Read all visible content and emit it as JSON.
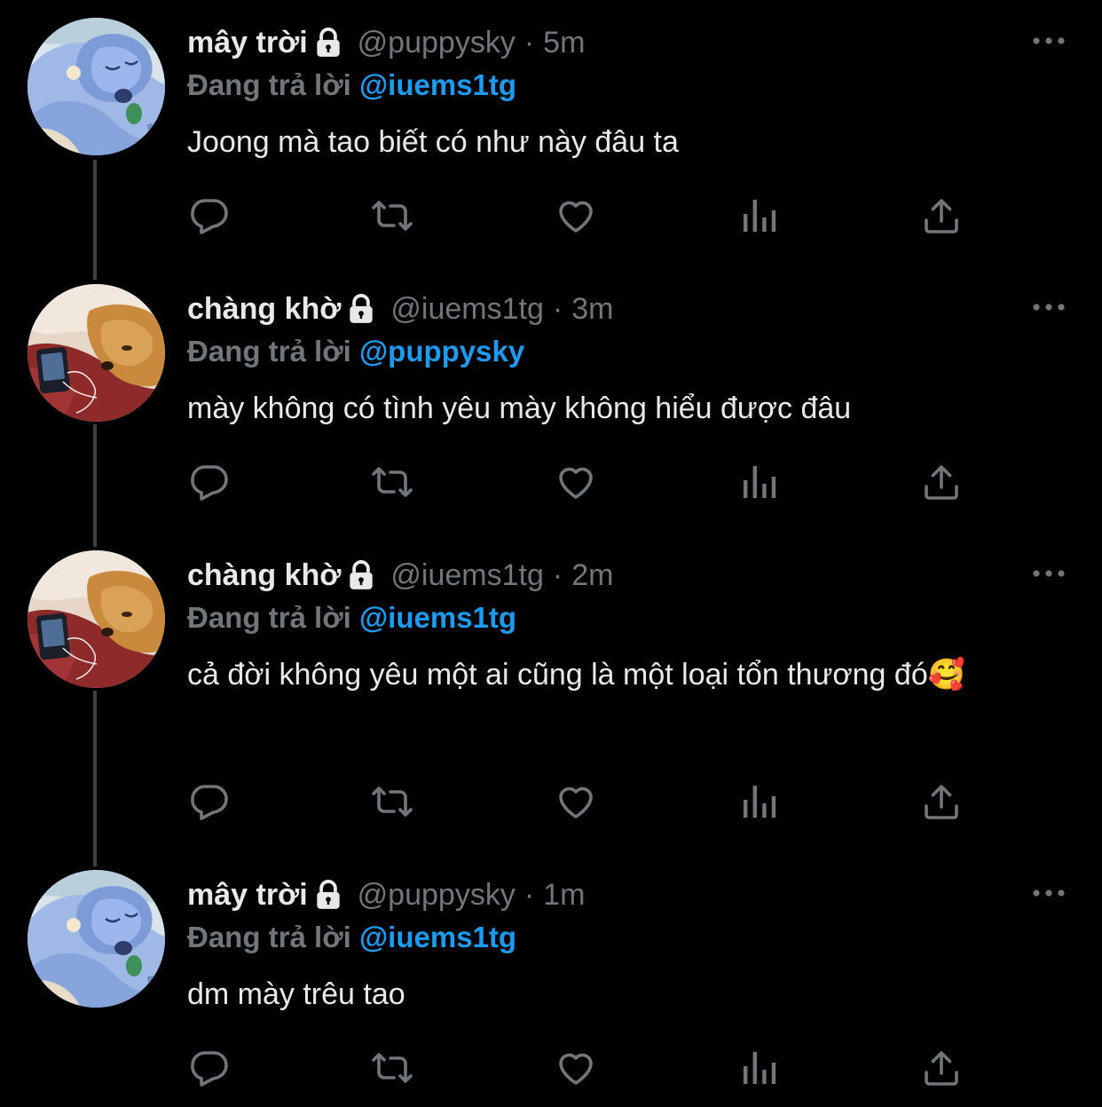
{
  "colors": {
    "background": "#000000",
    "text_primary": "#e7e9ea",
    "text_secondary": "#71767b",
    "accent": "#1d9bf0",
    "thread_line": "#3e4144"
  },
  "tweets": [
    {
      "display_name": "mây trời",
      "protected_icon": "lock-icon",
      "handle": "@puppysky",
      "separator": "·",
      "time": "5m",
      "reply_prefix": "Đang trả lời",
      "reply_to": "@iuems1tg",
      "text": "Joong mà tao biết có như này đâu ta",
      "avatar": "stitch-avatar"
    },
    {
      "display_name": "chàng khờ",
      "protected_icon": "lock-icon",
      "handle": "@iuems1tg",
      "separator": "·",
      "time": "3m",
      "reply_prefix": "Đang trả lời",
      "reply_to": "@puppysky",
      "text": "mày không có tình yêu mày không hiểu được đâu",
      "avatar": "dog-avatar"
    },
    {
      "display_name": "chàng khờ",
      "protected_icon": "lock-icon",
      "handle": "@iuems1tg",
      "separator": "·",
      "time": "2m",
      "reply_prefix": "Đang trả lời",
      "reply_to": "@iuems1tg",
      "text": "cả đời không yêu một ai cũng là một loại tổn thương đó🥰",
      "avatar": "dog-avatar"
    },
    {
      "display_name": "mây trời",
      "protected_icon": "lock-icon",
      "handle": "@puppysky",
      "separator": "·",
      "time": "1m",
      "reply_prefix": "Đang trả lời",
      "reply_to": "@iuems1tg",
      "text": "dm mày trêu tao",
      "avatar": "stitch-avatar"
    }
  ],
  "action_icons": [
    "reply-icon",
    "retweet-icon",
    "like-icon",
    "views-icon",
    "share-icon"
  ],
  "more_icon": "more-options-icon"
}
